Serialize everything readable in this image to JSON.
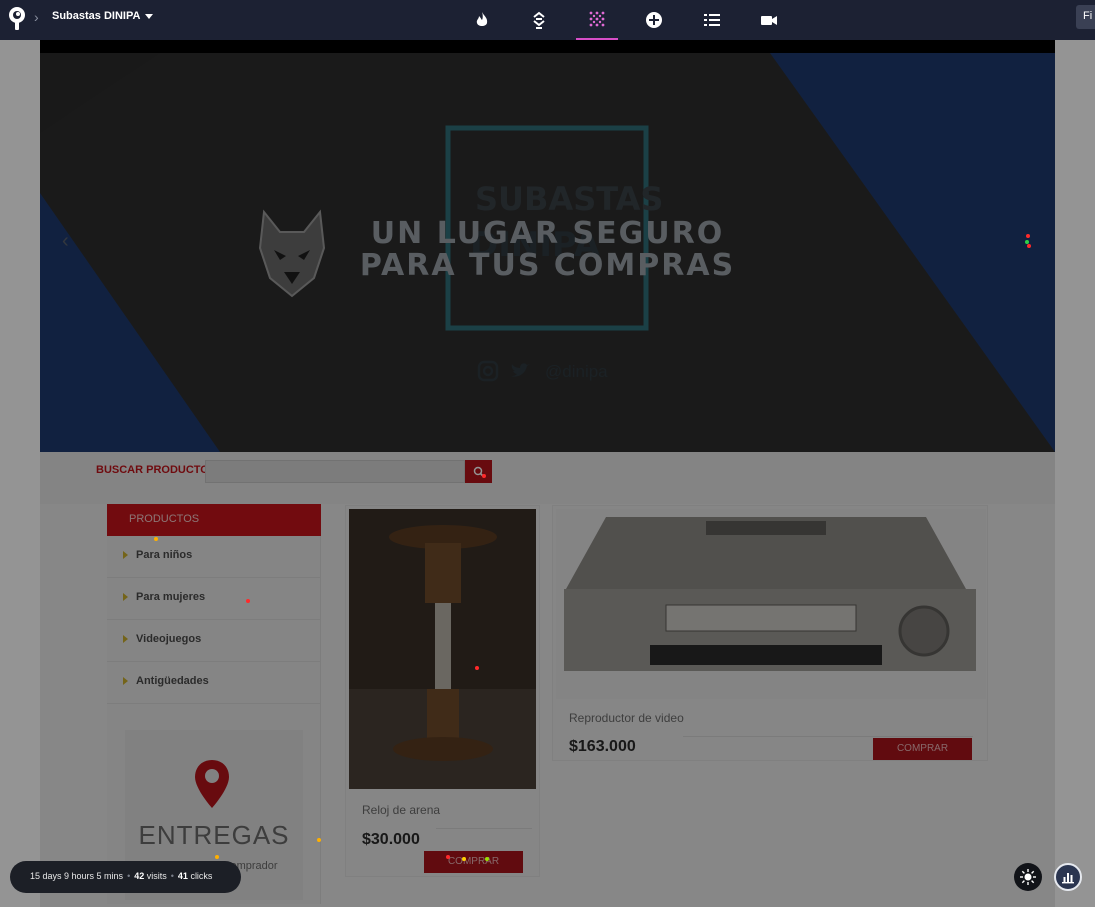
{
  "toolbar": {
    "site_name": "Subastas DINIPA",
    "right_button_label": "Fi",
    "icons": [
      "fire-icon",
      "scroll-depth-icon",
      "heatmap-dots-icon",
      "add-circle-icon",
      "list-icon",
      "video-camera-icon"
    ],
    "active_tool": "heatmap-dots-icon",
    "accent": "#d64ec7"
  },
  "hero": {
    "title_line1": "UN LUGAR SEGURO",
    "title_line2": "PARA TUS COMPRAS",
    "logo_word_top": "SUBASTAS",
    "logo_word_bottom": "DINIPA",
    "handle": "@dinipa",
    "prev_arrow": "‹"
  },
  "search": {
    "label": "BUSCAR PRODUCTO",
    "placeholder": ""
  },
  "sidebar": {
    "header": "PRODUCTOS",
    "categories": [
      "Para niños",
      "Para mujeres",
      "Videojuegos",
      "Antigüedades"
    ],
    "delivery_title": "ENTREGAS",
    "delivery_sub": "comprador"
  },
  "products": [
    {
      "name": "Reloj de arena",
      "price": "$30.000",
      "button": "COMPRAR"
    },
    {
      "name": "Reproductor de video",
      "price": "$163.000",
      "button": "COMPRAR"
    }
  ],
  "stats": {
    "duration": "15 days 9 hours 5 mins",
    "visits_count": "42",
    "visits_label": "visits",
    "clicks_count": "41",
    "clicks_label": "clicks"
  },
  "colors": {
    "brand_red": "#c4141b",
    "hero_blue": "#1e3a6e",
    "toolbar_bg": "#1c2133"
  }
}
